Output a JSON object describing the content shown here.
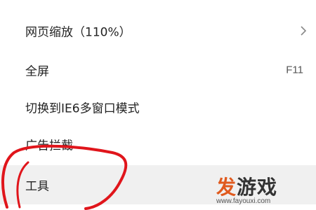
{
  "menu": {
    "items": [
      {
        "label": "网页缩放（110%）",
        "has_submenu": true,
        "shortcut": ""
      },
      {
        "label": "全屏",
        "has_submenu": false,
        "shortcut": "F11"
      },
      {
        "label": "切换到IE6多窗口模式",
        "has_submenu": false,
        "shortcut": ""
      },
      {
        "label": "广告拦截",
        "has_submenu": false,
        "shortcut": ""
      },
      {
        "label": "工具",
        "has_submenu": false,
        "shortcut": "",
        "highlighted": true
      }
    ]
  },
  "annotation": {
    "color": "#e0151b",
    "description_icon": "red-freehand-circle"
  },
  "watermark": {
    "accent_char": "发",
    "rest": "游戏",
    "url": "www.fayouxi.com"
  },
  "colors": {
    "highlight_bg": "#f0f0f0",
    "text": "#222222",
    "watermark_accent": "#e05a1e"
  }
}
